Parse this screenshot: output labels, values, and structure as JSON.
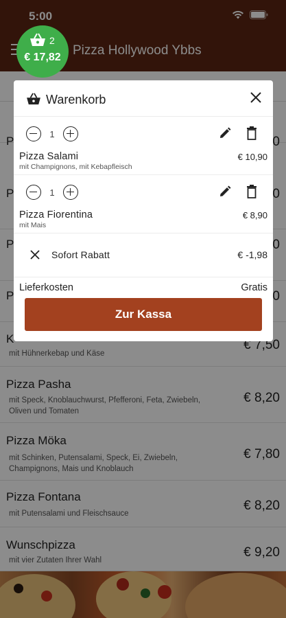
{
  "status_bar": {
    "time": "5:00"
  },
  "header": {
    "title": "Pizza Hollywood Ybbs"
  },
  "cart_bubble": {
    "count": "2",
    "total": "€ 17,82"
  },
  "menu_items": [
    {
      "name": "P",
      "description": "",
      "price": "0"
    },
    {
      "name": "P",
      "description": "",
      "price": "0"
    },
    {
      "name": "P",
      "description": "",
      "price": "0"
    },
    {
      "name": "P",
      "description": "",
      "price": "0"
    },
    {
      "name": "K",
      "description": "mit Hühnerkebap und Käse",
      "price": "€ 7,50"
    },
    {
      "name": "Pizza Pasha",
      "description": "mit Speck, Knoblauchwurst, Pfefferoni, Feta, Zwiebeln, Oliven und Tomaten",
      "price": "€ 8,20"
    },
    {
      "name": "Pizza Möka",
      "description": "mit Schinken, Putensalami, Speck, Ei, Zwiebeln, Champignons, Mais und Knoblauch",
      "price": "€ 7,80"
    },
    {
      "name": "Pizza Fontana",
      "description": "mit Putensalami und Fleischsauce",
      "price": "€ 8,20"
    },
    {
      "name": "Wunschpizza",
      "description": "mit vier Zutaten Ihrer Wahl",
      "price": "€ 9,20"
    }
  ],
  "cart": {
    "title": "Warenkorb",
    "items": [
      {
        "quantity": "1",
        "name": "Pizza Salami",
        "description": "mit Champignons, mit Kebapfleisch",
        "price": "€ 10,90"
      },
      {
        "quantity": "1",
        "name": "Pizza Fiorentina",
        "description": "mit Mais",
        "price": "€ 8,90"
      }
    ],
    "discount": {
      "label": "Sofort Rabatt",
      "value": "€ -1,98"
    },
    "delivery": {
      "label": "Lieferkosten",
      "value": "Gratis"
    },
    "checkout_label": "Zur Kassa"
  },
  "colors": {
    "header": "#5b2613",
    "accent": "#a3411f",
    "bubble": "#3fae4a"
  },
  "icons": [
    "wifi-icon",
    "battery-icon",
    "menu-icon",
    "basket-icon",
    "close-icon",
    "minus-icon",
    "plus-icon",
    "pencil-icon",
    "trash-icon",
    "x-icon"
  ]
}
